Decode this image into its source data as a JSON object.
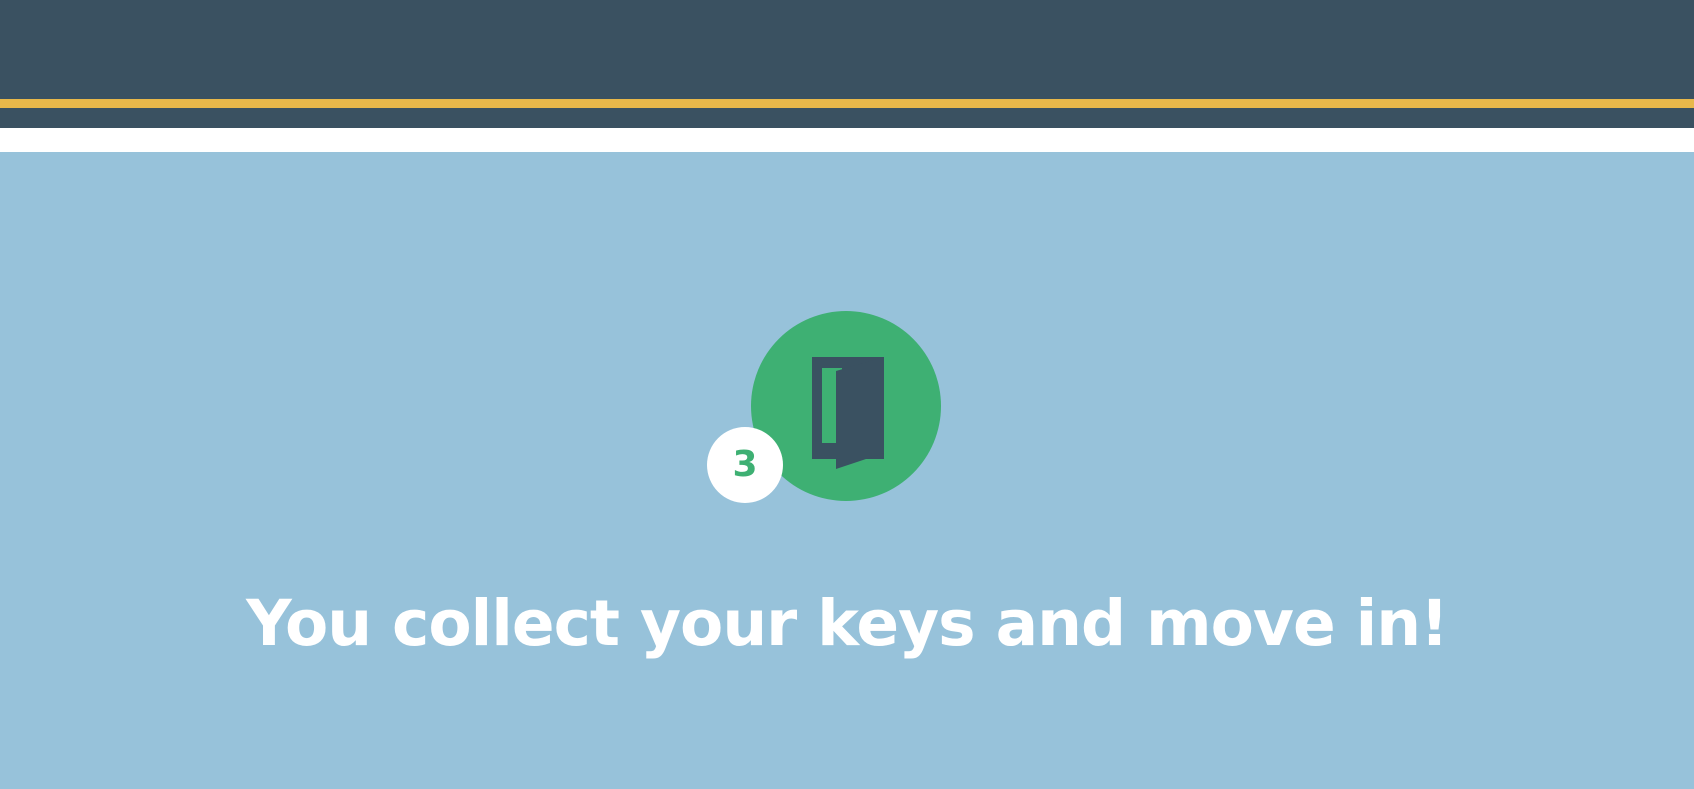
{
  "step": {
    "number": "3",
    "icon": "door-icon",
    "headline": "You collect your keys and move in!"
  },
  "colors": {
    "header_background": "#3a5161",
    "header_accent": "#e8b84a",
    "content_background": "#97c2da",
    "step_circle": "#3eb073",
    "badge_background": "#ffffff",
    "headline_text": "#ffffff"
  }
}
